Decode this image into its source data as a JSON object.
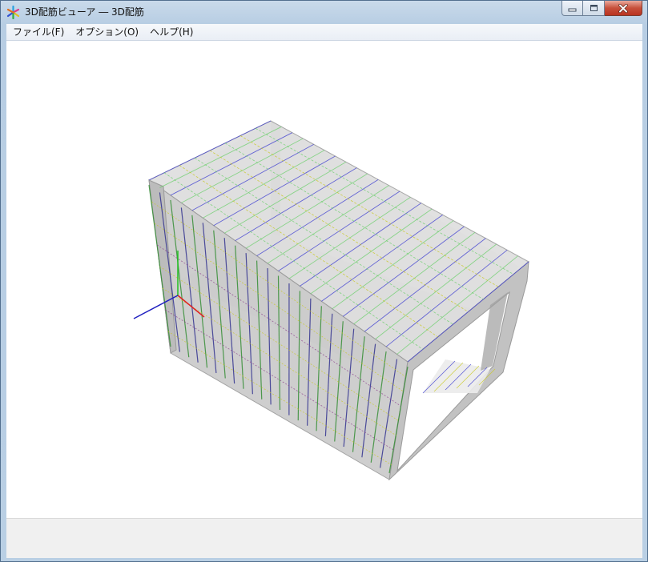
{
  "window": {
    "title": "3D配筋ビューア ― 3D配筋",
    "icon": "app-star-icon"
  },
  "caption": {
    "minimize_icon": "minimize-icon",
    "maximize_icon": "maximize-icon",
    "close_icon": "close-icon",
    "close_color": "#c7503b"
  },
  "menu": {
    "items": [
      {
        "label": "ファイル(F)"
      },
      {
        "label": "オプション(O)"
      },
      {
        "label": "ヘルプ(H)"
      }
    ]
  },
  "scene": {
    "concrete_color": "#b9b9b9",
    "rebar_colors": [
      "#2a2a8c",
      "#2c8a2c",
      "#8a3a8a",
      "#c8c820",
      "#3a3ad0",
      "#6ccf6c"
    ],
    "axis_colors": {
      "x": "#e02020",
      "y": "#20c020",
      "z": "#2020c0"
    }
  },
  "status": {
    "text": ""
  }
}
